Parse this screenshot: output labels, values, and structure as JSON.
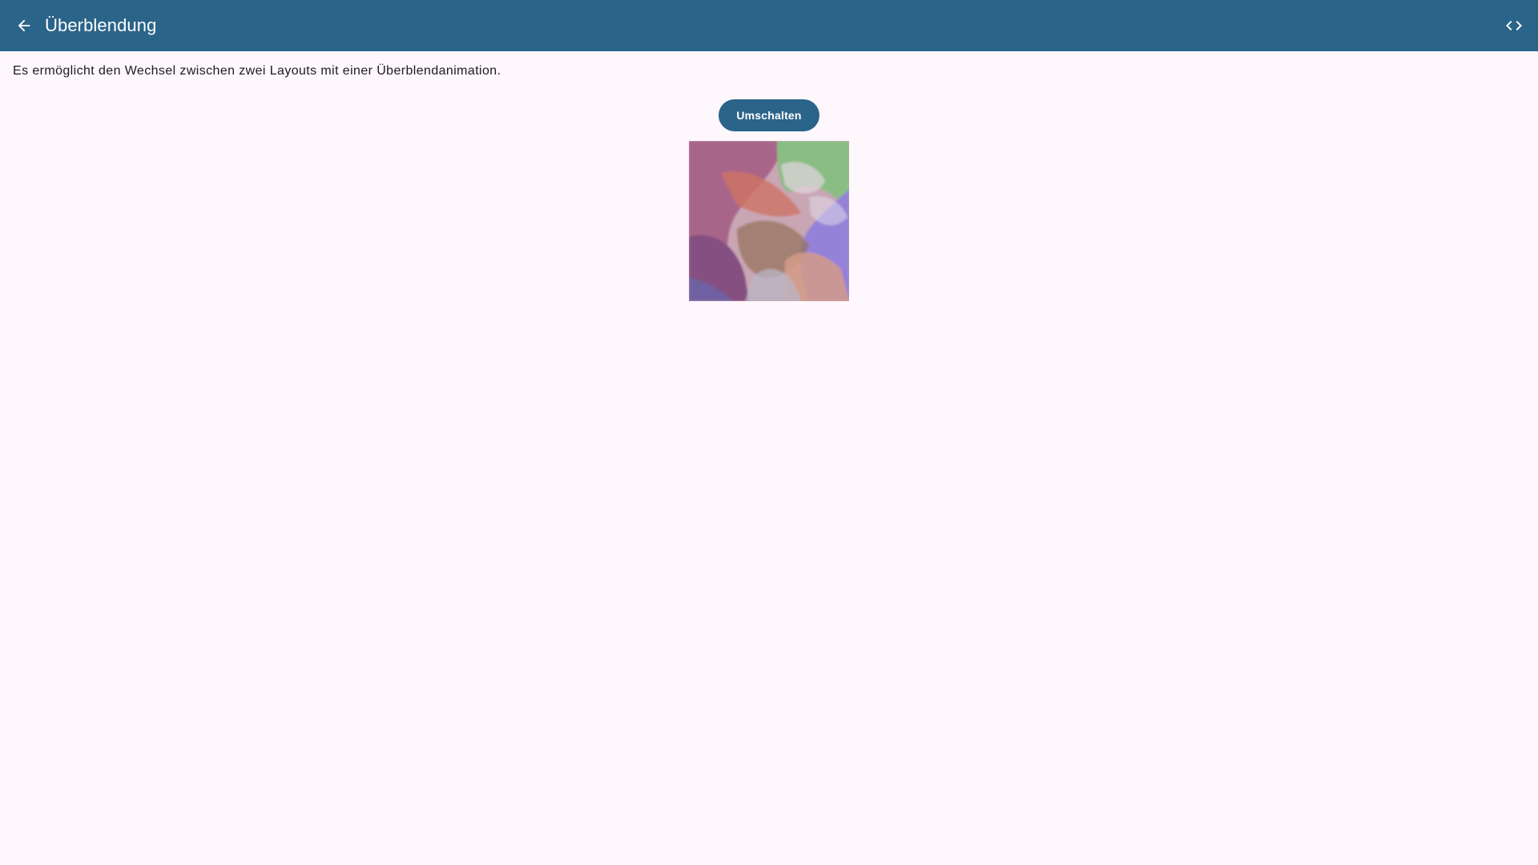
{
  "appbar": {
    "title": "Überblendung",
    "back_icon": "arrow-back-icon",
    "code_icon": "code-icon",
    "background_color": "#2b6489"
  },
  "main": {
    "description": "Es ermöglicht den Wechsel zwischen zwei Layouts mit einer Überblendanimation.",
    "toggle_button_label": "Umschalten",
    "image_name": "abstract-overlapping-shapes-image"
  },
  "colors": {
    "page_background": "#fef7fc",
    "accent": "#2b6489",
    "text": "#1d1b20"
  }
}
